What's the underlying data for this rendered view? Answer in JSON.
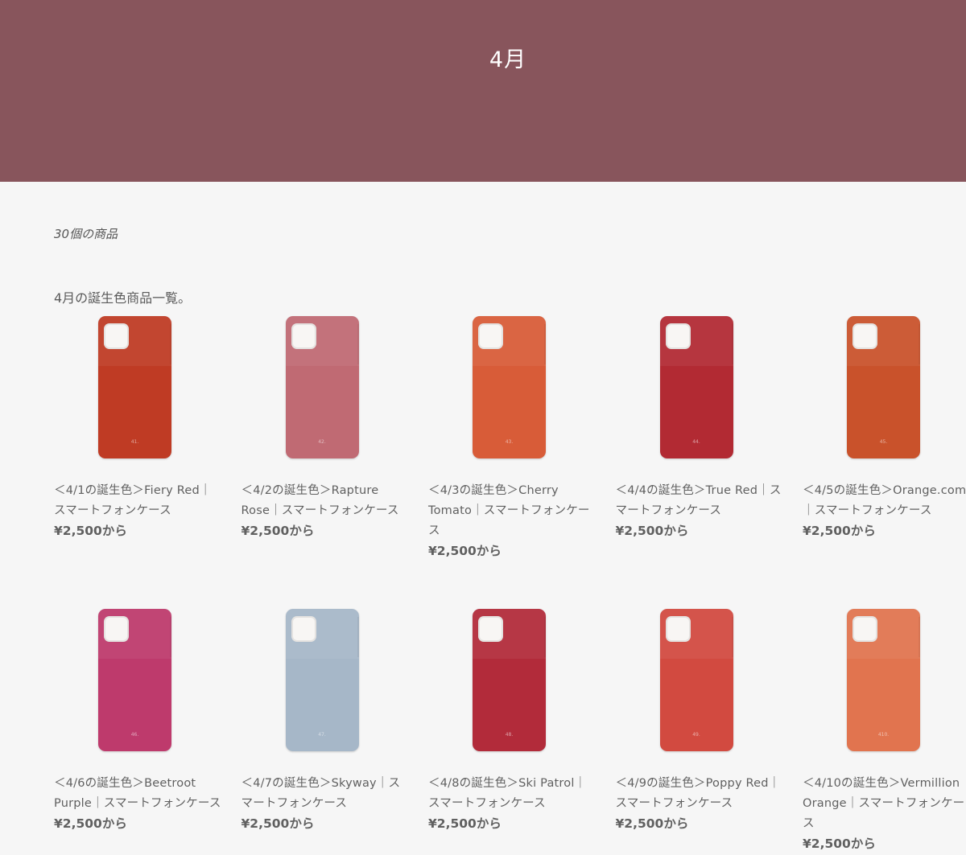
{
  "collection": {
    "title": "4月",
    "count": "30個の商品",
    "description": "4月の誕生色商品一覧。"
  },
  "products": [
    {
      "title": "＜4/1の誕生色＞Fiery Red｜スマートフォンケース",
      "price": "¥2,500から",
      "number": "41.",
      "color": "#bf3b24"
    },
    {
      "title": "＜4/2の誕生色＞Rapture Rose｜スマートフォンケース",
      "price": "¥2,500から",
      "number": "42.",
      "color": "#c06a73"
    },
    {
      "title": "＜4/3の誕生色＞Cherry Tomato｜スマートフォンケース",
      "price": "¥2,500から",
      "number": "43.",
      "color": "#d85c38"
    },
    {
      "title": "＜4/4の誕生色＞True Red｜スマートフォンケース",
      "price": "¥2,500から",
      "number": "44.",
      "color": "#b22a33"
    },
    {
      "title": "＜4/5の誕生色＞Orange.com｜スマートフォンケース",
      "price": "¥2,500から",
      "number": "45.",
      "color": "#c9522b"
    },
    {
      "title": "＜4/6の誕生色＞Beetroot Purple｜スマートフォンケース",
      "price": "¥2,500から",
      "number": "46.",
      "color": "#be3a6c"
    },
    {
      "title": "＜4/7の誕生色＞Skyway｜スマートフォンケース",
      "price": "¥2,500から",
      "number": "47.",
      "color": "#a6b7c8"
    },
    {
      "title": "＜4/8の誕生色＞Ski Patrol｜スマートフォンケース",
      "price": "¥2,500から",
      "number": "48.",
      "color": "#b22b3a"
    },
    {
      "title": "＜4/9の誕生色＞Poppy Red｜スマートフォンケース",
      "price": "¥2,500から",
      "number": "49.",
      "color": "#d24a40"
    },
    {
      "title": "＜4/10の誕生色＞Vermillion Orange｜スマートフォンケース",
      "price": "¥2,500から",
      "number": "410.",
      "color": "#e1744f"
    }
  ]
}
